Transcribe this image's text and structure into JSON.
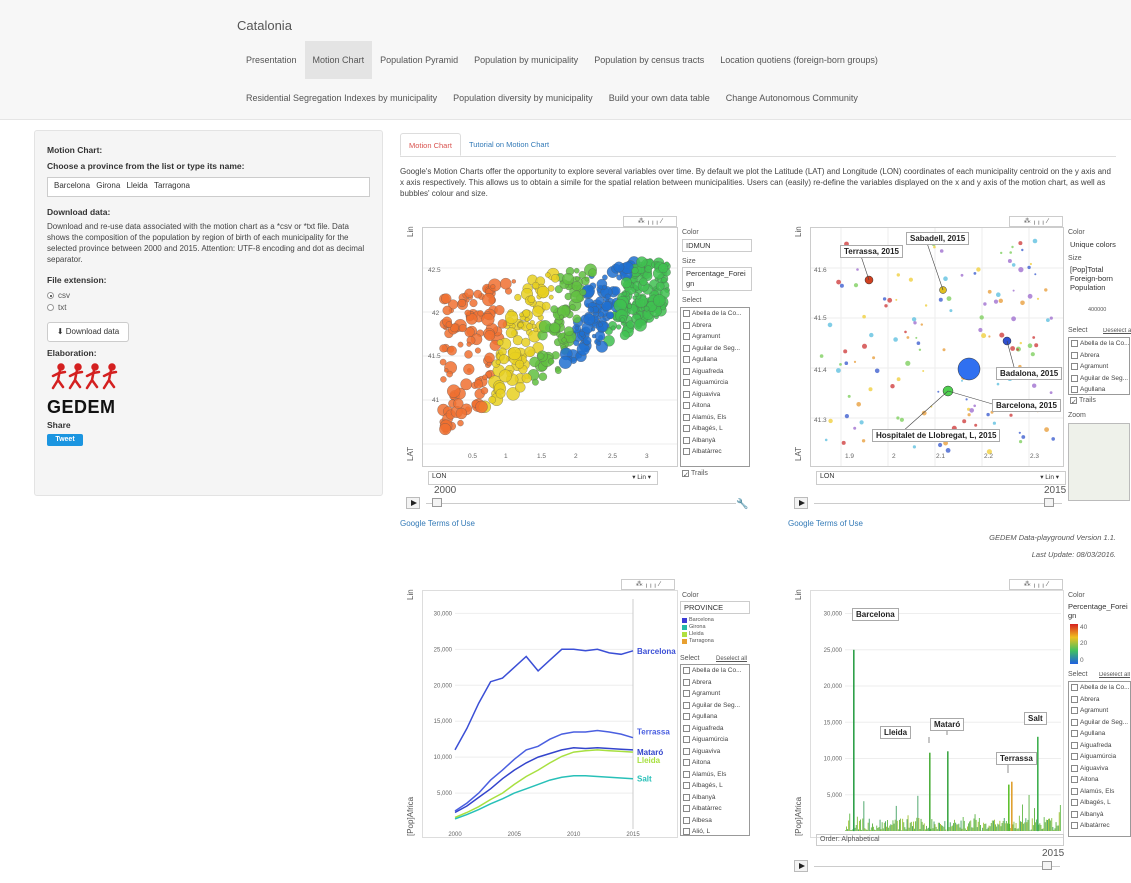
{
  "nav": {
    "brand": "Catalonia",
    "row1": [
      "Presentation",
      "Motion Chart",
      "Population Pyramid",
      "Population by municipality",
      "Population by census tracts",
      "Location quotiens (foreign-born groups)"
    ],
    "row2": [
      "Residential Segregation Indexes by municipality",
      "Population diversity by municipality",
      "Build your own data table",
      "Change Autonomous Community"
    ]
  },
  "sidebar": {
    "title": "Motion Chart:",
    "choose_label": "Choose a province from the list or type its name:",
    "provinces": [
      "Barcelona",
      "Girona",
      "Lleida",
      "Tarragona"
    ],
    "download_title": "Download data:",
    "download_text": "Download and re-use data associated with the motion chart as a *csv or *txt file. Data shows the composition of the population by region of birth of each municipality for the selected province between 2000 and 2015. Attention: UTF-8 encoding and dot as decimal separator.",
    "file_ext_label": "File extension:",
    "opt_csv": "csv",
    "opt_txt": "txt",
    "download_button": "Download data",
    "elaboration": "Elaboration:",
    "logo_text": "GEDEM",
    "share": "Share",
    "tweet": "Tweet"
  },
  "tabs": [
    "Motion Chart",
    "Tutorial on Motion Chart"
  ],
  "intro": "Google's Motion Charts offer the opportunity to explore several variables over time. By default we plot the Latitude (LAT) and Longitude (LON) coordinates of each municipality centroid on the y axis and x axis respectively. This allows us to obtain a simile for the spatial relation between municipalities. Users can (easily) re-define the variables displayed on the x and y axis of the motion chart, as well as bubbles' colour and size.",
  "municipalities": [
    "Abella de la Co...",
    "Abrera",
    "Agramunt",
    "Aguilar de Seg...",
    "Agullana",
    "Aiguafreda",
    "Aiguamúrcia",
    "Aiguaviva",
    "Aitona",
    "Alamús, Els",
    "Albagés, L",
    "Albanyà",
    "Albatàrrec",
    "Albesa",
    "Alió, L"
  ],
  "common": {
    "lin": "Lin",
    "select": "Select",
    "deselect": "Deselect all",
    "trails": "Trails",
    "terms": "Google Terms of Use",
    "color_label": "Color",
    "size_label": "Size",
    "zoom": "Zoom"
  },
  "chart1": {
    "color_value": "IDMUN",
    "size_value": "Percentage_Foreign",
    "ylabel": "LAT",
    "xlabel": "LON",
    "year": "2000",
    "yticks": [
      "42.5",
      "42",
      "41.5",
      "41"
    ],
    "xticks": [
      "0.5",
      "1",
      "1.5",
      "2",
      "2.5",
      "3"
    ]
  },
  "chart2": {
    "color_value": "Unique colors",
    "size_value": "[Pop]Total Foreign-born Population",
    "size_scale": "400000",
    "ylabel": "LAT",
    "xlabel": "LON",
    "year": "2015",
    "yticks": [
      "41.6",
      "41.5",
      "41.4",
      "41.3"
    ],
    "xticks": [
      "1.9",
      "2",
      "2.1",
      "2.2",
      "2.3"
    ],
    "labels": [
      "Terrassa, 2015",
      "Sabadell, 2015",
      "Badalona, 2015",
      "Barcelona, 2015",
      "Hospitalet de Llobregat, L, 2015"
    ]
  },
  "chart3": {
    "color_value": "PROVINCE",
    "legend": [
      "Barcelona",
      "Girona",
      "Lleida",
      "Tarragona"
    ],
    "legend_colors": [
      "#3b3bd6",
      "#26b8a8",
      "#b0e040",
      "#e8a030"
    ],
    "ylabel": "[Pop]Africa",
    "yticks": [
      "30,000",
      "25,000",
      "20,000",
      "15,000",
      "10,000",
      "5,000"
    ],
    "xticks": [
      "2000",
      "2005",
      "2010",
      "2015"
    ]
  },
  "chart4": {
    "color_value": "Percentage_Foreign",
    "scale": [
      "40",
      "20",
      "0"
    ],
    "ylabel": "[Pop]Africa",
    "order": "Order: Alphabetical",
    "year": "2015",
    "yticks": [
      "30,000",
      "25,000",
      "20,000",
      "15,000",
      "10,000",
      "5,000"
    ],
    "labels": [
      "Barcelona",
      "Lleida",
      "Mataró",
      "Terrassa",
      "Salt"
    ]
  },
  "footer": {
    "version": "GEDEM Data-playground Version 1.1.",
    "update": "Last Update: 08/03/2016."
  },
  "chart_data": {
    "type": "line",
    "x": [
      2000,
      2001,
      2002,
      2003,
      2004,
      2005,
      2006,
      2007,
      2008,
      2009,
      2010,
      2011,
      2012,
      2013,
      2014,
      2015
    ],
    "ylabel": "[Pop]Africa",
    "series": [
      {
        "name": "Barcelona",
        "values": [
          11000,
          14000,
          17500,
          20500,
          21000,
          22500,
          24000,
          22000,
          23500,
          25000,
          25000,
          24800,
          25000,
          24500,
          24300,
          24800
        ]
      },
      {
        "name": "Terrassa",
        "values": [
          2500,
          3600,
          5000,
          6800,
          8200,
          9700,
          11000,
          11500,
          12500,
          13200,
          13500,
          13500,
          13700,
          13500,
          13200,
          12700
        ]
      },
      {
        "name": "Mataró",
        "values": [
          2300,
          3200,
          4400,
          5600,
          7000,
          8200,
          9200,
          10000,
          10500,
          11000,
          11300,
          11200,
          11300,
          11200,
          11100,
          11000
        ]
      },
      {
        "name": "Lleida",
        "values": [
          1600,
          2300,
          3100,
          4100,
          5000,
          6200,
          7300,
          8200,
          9200,
          10100,
          10700,
          10900,
          11000,
          10900,
          10800,
          10700
        ]
      },
      {
        "name": "Salt",
        "values": [
          1400,
          2000,
          2700,
          3500,
          4200,
          5000,
          5600,
          6200,
          6800,
          7200,
          7400,
          7400,
          7300,
          7200,
          7100,
          7000
        ]
      }
    ]
  }
}
